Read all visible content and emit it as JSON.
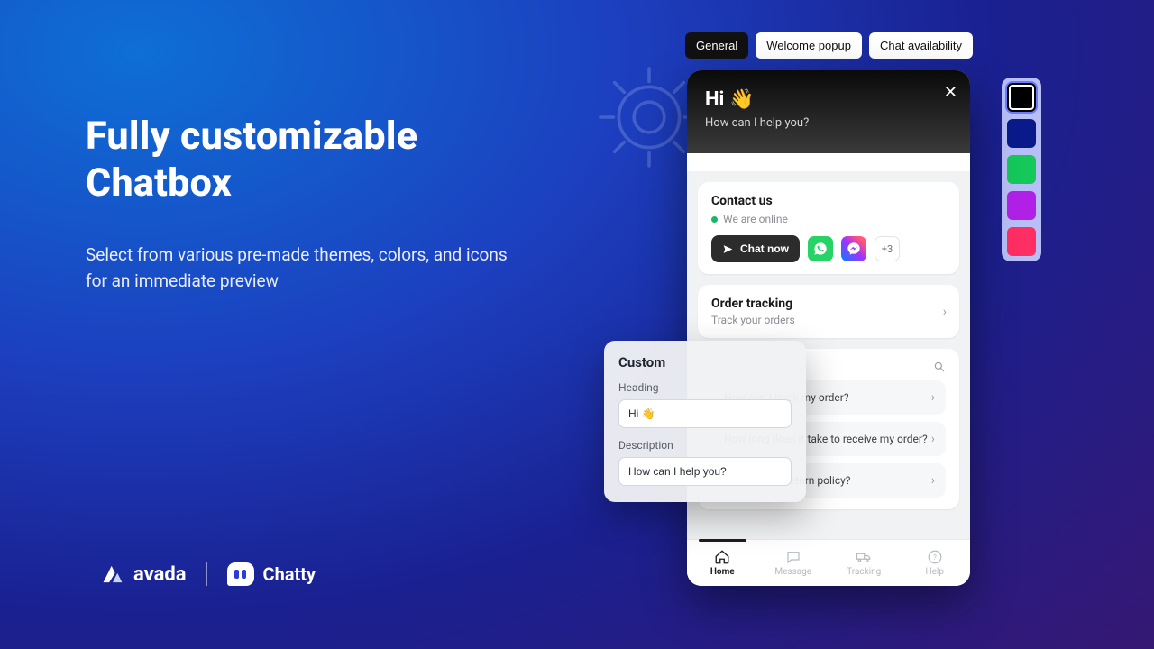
{
  "hero": {
    "title_l1": "Fully customizable",
    "title_l2": "Chatbox",
    "desc": "Select from various pre-made themes, colors, and icons for an immediate preview"
  },
  "logos": {
    "avada": "avada",
    "chatty": "Chatty"
  },
  "tabs": {
    "general": "General",
    "welcome": "Welcome popup",
    "availability": "Chat availability"
  },
  "swatches": {
    "colors": [
      "#000000",
      "#0a1a8a",
      "#15c85a",
      "#b020e6",
      "#ff2e63"
    ],
    "selected_index": 0
  },
  "chat": {
    "greeting": "Hi",
    "wave": "👋",
    "subline": "How can I help you?",
    "contact": {
      "title": "Contact us",
      "status": "We are online",
      "chat_now": "Chat now",
      "more_count": "+3"
    },
    "tracking": {
      "title": "Order tracking",
      "sub": "Track your orders"
    },
    "faq": {
      "items": [
        "How can I track my order?",
        "How long does it take to receive my order?",
        "What is your return policy?"
      ]
    },
    "tabbar": {
      "home": "Home",
      "message": "Message",
      "tracking": "Tracking",
      "help": "Help"
    }
  },
  "editor": {
    "title": "Custom",
    "heading_label": "Heading",
    "heading_value": "Hi 👋",
    "desc_label": "Description",
    "desc_value": "How can I help you?"
  }
}
